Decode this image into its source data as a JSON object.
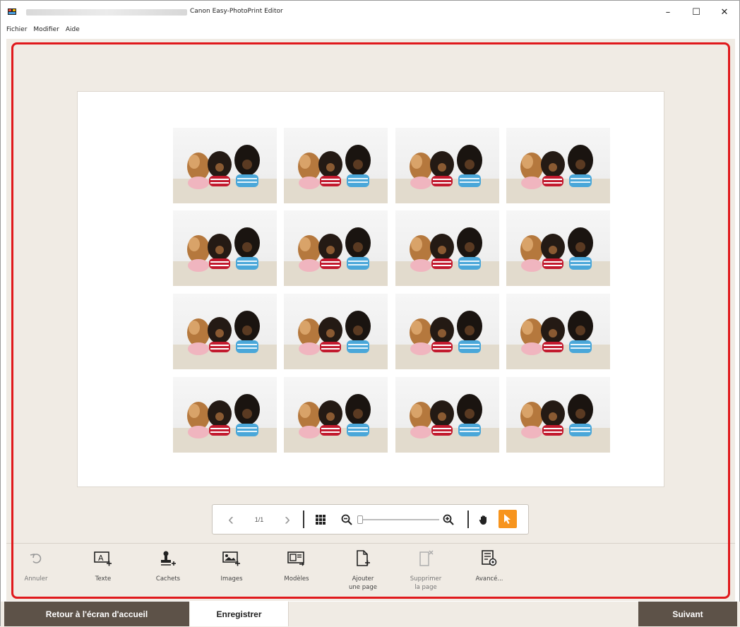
{
  "window": {
    "title": "Canon Easy-PhotoPrint Editor",
    "minimize_glyph": "–",
    "maximize_glyph": "☐",
    "close_glyph": "✕"
  },
  "menu": [
    "Fichier",
    "Modifier",
    "Aide"
  ],
  "canvas": {
    "photo_rows": 4,
    "photo_columns": 4
  },
  "navigation": {
    "page_indicator": "1/1",
    "prev_glyph": "‹",
    "next_glyph": "›"
  },
  "tools": [
    {
      "label": "Annuler",
      "icon": "undo-icon",
      "enabled": false
    },
    {
      "label": "Texte",
      "icon": "text-icon",
      "enabled": true
    },
    {
      "label": "Cachets",
      "icon": "stamp-icon",
      "enabled": true
    },
    {
      "label": "Images",
      "icon": "image-icon",
      "enabled": true
    },
    {
      "label": "Modèles",
      "icon": "template-icon",
      "enabled": true
    },
    {
      "label": "Ajouter\nune page",
      "icon": "add-page-icon",
      "enabled": true
    },
    {
      "label": "Supprimer\nla page",
      "icon": "delete-page-icon",
      "enabled": false
    },
    {
      "label": "Avancé...",
      "icon": "advanced-icon",
      "enabled": true
    }
  ],
  "bottom": {
    "home_label": "Retour à l'écran d'accueil",
    "save_label": "Enregistrer",
    "next_label": "Suivant"
  },
  "colors": {
    "highlight": "#e0191c",
    "dark_button": "#5d5248",
    "active_tool": "#f7941d",
    "workspace": "#f0ebe4"
  }
}
